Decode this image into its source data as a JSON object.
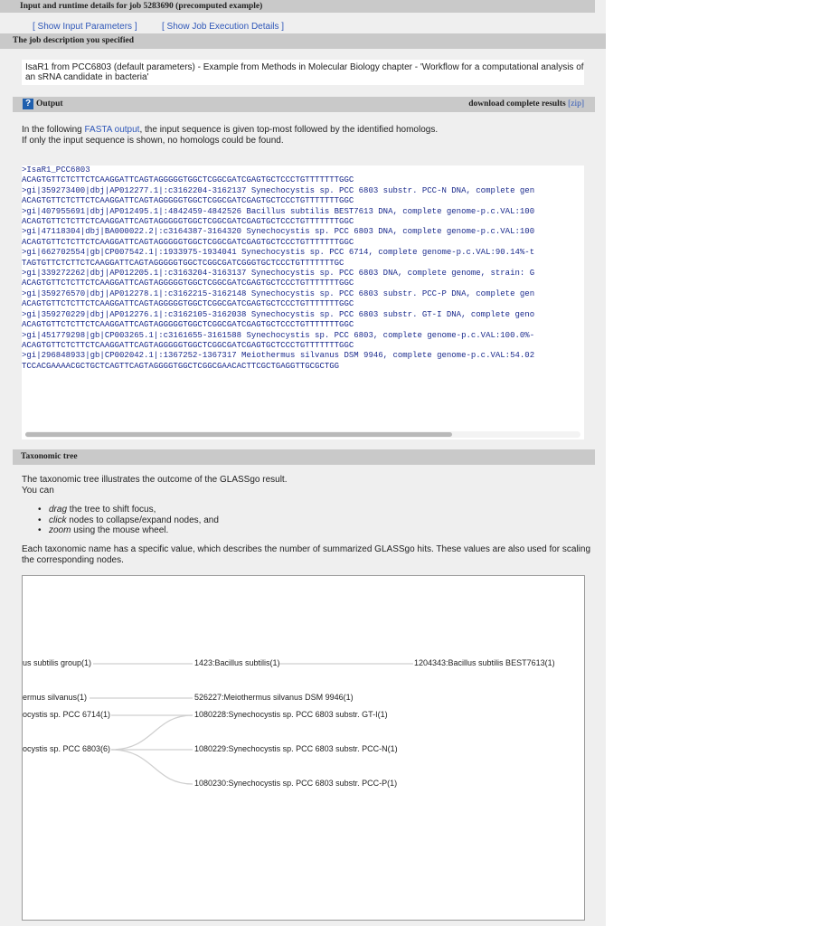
{
  "job_header": "Input and runtime details for job 5283690 (precomputed example)",
  "links": {
    "show_input": "[ Show Input Parameters ]",
    "show_execution": "[ Show Job Execution Details ]"
  },
  "job_description": {
    "title": "The job description you specified",
    "text_line1": "IsaR1 from PCC6803 (default parameters) - Example from Methods in Molecular Biology chapter - 'Workflow for a computational analysis of",
    "text_line2": "an sRNA candidate in bacteria'"
  },
  "output": {
    "help_icon_glyph": "?",
    "title": "Output",
    "download_label": "download complete results",
    "download_link": "[zip]",
    "intro_prefix": "In the following ",
    "intro_link": "FASTA output",
    "intro_suffix": ", the input sequence is given top-most followed by the identified homologs.",
    "intro_line2": "If only the input sequence is shown, no homologs could be found.",
    "fasta_lines": [
      ">IsaR1_PCC6803",
      "ACAGTGTTCTCTTCTCAAGGATTCAGTAGGGGGTGGCTCGGCGATCGAGTGCTCCCTGTTTTTTTGGC",
      ">gi|359273400|dbj|AP012277.1|:c3162204-3162137 Synechocystis sp. PCC 6803 substr. PCC-N DNA, complete gen",
      "ACAGTGTTCTCTTCTCAAGGATTCAGTAGGGGGTGGCTCGGCGATCGAGTGCTCCCTGTTTTTTTGGC",
      ">gi|407955691|dbj|AP012495.1|:4842459-4842526 Bacillus subtilis BEST7613 DNA, complete genome-p.c.VAL:100",
      "ACAGTGTTCTCTTCTCAAGGATTCAGTAGGGGGTGGCTCGGCGATCGAGTGCTCCCTGTTTTTTTGGC",
      ">gi|47118304|dbj|BA000022.2|:c3164387-3164320 Synechocystis sp. PCC 6803 DNA, complete genome-p.c.VAL:100",
      "ACAGTGTTCTCTTCTCAAGGATTCAGTAGGGGGTGGCTCGGCGATCGAGTGCTCCCTGTTTTTTTGGC",
      ">gi|662702554|gb|CP007542.1|:1933975-1934041 Synechocystis sp. PCC 6714, complete genome-p.c.VAL:90.14%-t",
      "TAGTGTTCTCTTCTCAAGGATTCAGTAGGGGGTGGCTCGGCGATCGGGTGCTCCCTGTTTTTTTGC",
      ">gi|339272262|dbj|AP012205.1|:c3163204-3163137 Synechocystis sp. PCC 6803 DNA, complete genome, strain: G",
      "ACAGTGTTCTCTTCTCAAGGATTCAGTAGGGGGTGGCTCGGCGATCGAGTGCTCCCTGTTTTTTTGGC",
      ">gi|359276570|dbj|AP012278.1|:c3162215-3162148 Synechocystis sp. PCC 6803 substr. PCC-P DNA, complete gen",
      "ACAGTGTTCTCTTCTCAAGGATTCAGTAGGGGGTGGCTCGGCGATCGAGTGCTCCCTGTTTTTTTGGC",
      ">gi|359270229|dbj|AP012276.1|:c3162105-3162038 Synechocystis sp. PCC 6803 substr. GT-I DNA, complete geno",
      "ACAGTGTTCTCTTCTCAAGGATTCAGTAGGGGGTGGCTCGGCGATCGAGTGCTCCCTGTTTTTTTGGC",
      ">gi|451779298|gb|CP003265.1|:c3161655-3161588 Synechocystis sp. PCC 6803, complete genome-p.c.VAL:100.0%-",
      "ACAGTGTTCTCTTCTCAAGGATTCAGTAGGGGGTGGCTCGGCGATCGAGTGCTCCCTGTTTTTTTGGC",
      ">gi|296848933|gb|CP002042.1|:1367252-1367317 Meiothermus silvanus DSM 9946, complete genome-p.c.VAL:54.02",
      "TCCACGAAAACGCTGCTCAGTTCAGTAGGGGTGGCTCGGCGAACACTTCGCTGAGGTTGCGCTGG"
    ]
  },
  "taxonomic_tree": {
    "title": "Taxonomic tree",
    "intro_line1": "The taxonomic tree illustrates the outcome of the GLASSgo result.",
    "intro_line2": "You can",
    "bullets": [
      {
        "em": "drag",
        "rest": " the tree to shift focus,"
      },
      {
        "em": "click",
        "rest": " nodes to collapse/expand nodes, and"
      },
      {
        "em": "zoom",
        "rest": " using the mouse wheel."
      }
    ],
    "note_line1": "Each taxonomic name has a specific value, which describes the number of summarized GLASSgo hits. These values are also used for scaling",
    "note_line2": "the corresponding nodes.",
    "nodes": {
      "bacillus_group": "us subtilis group(1)",
      "bacillus_subtilis": "1423:Bacillus subtilis(1)",
      "bacillus_best": "1204343:Bacillus subtilis BEST7613(1)",
      "meiothermus": "ermus silvanus(1)",
      "meiothermus_dsm": "526227:Meiothermus silvanus DSM 9946(1)",
      "syn_6714": "ocystis sp. PCC 6714(1)",
      "syn_gti": "1080228:Synechocystis sp. PCC 6803 substr. GT-I(1)",
      "syn_6803": "ocystis sp. PCC 6803(6)",
      "syn_pccn": "1080229:Synechocystis sp. PCC 6803 substr. PCC-N(1)",
      "syn_pccp": "1080230:Synechocystis sp. PCC 6803 substr. PCC-P(1)"
    }
  }
}
